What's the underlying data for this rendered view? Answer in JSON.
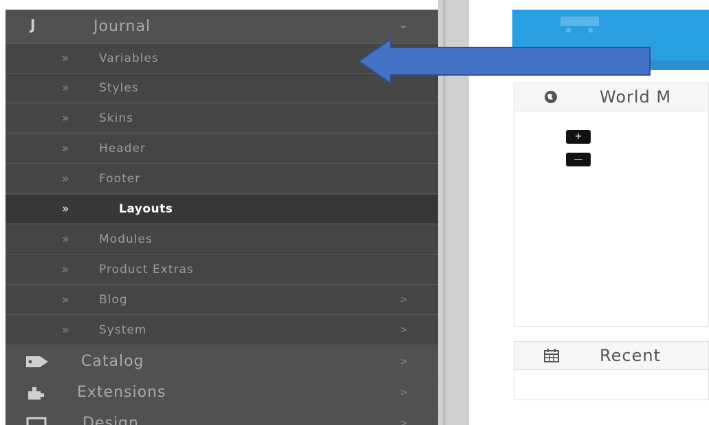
{
  "sidebar": {
    "journal": {
      "icon": "journal-j-icon",
      "label": "Journal"
    },
    "sub_items": [
      {
        "label": "Variables",
        "active": false,
        "has_submenu": false
      },
      {
        "label": "Styles",
        "active": false,
        "has_submenu": false
      },
      {
        "label": "Skins",
        "active": false,
        "has_submenu": false
      },
      {
        "label": "Header",
        "active": false,
        "has_submenu": false
      },
      {
        "label": "Footer",
        "active": false,
        "has_submenu": false
      },
      {
        "label": "Layouts",
        "active": true,
        "has_submenu": false
      },
      {
        "label": "Modules",
        "active": false,
        "has_submenu": false
      },
      {
        "label": "Product Extras",
        "active": false,
        "has_submenu": false
      },
      {
        "label": "Blog",
        "active": false,
        "has_submenu": true
      },
      {
        "label": "System",
        "active": false,
        "has_submenu": true
      }
    ],
    "top_items": [
      {
        "label": "Catalog",
        "icon": "tags-icon"
      },
      {
        "label": "Extensions",
        "icon": "puzzle-icon"
      },
      {
        "label": "Design",
        "icon": "monitor-icon"
      }
    ],
    "chevron_down": "⌄",
    "chevron_right": ">"
  },
  "main": {
    "banner": {
      "icon": "shopping-cart-icon",
      "color": "#279fe0"
    },
    "world_map": {
      "title": "World M",
      "icon": "globe-icon",
      "zoom_in": "+",
      "zoom_out": "—"
    },
    "recent": {
      "title": "Recent",
      "icon": "calendar-icon"
    }
  },
  "annotation": {
    "arrow_color": "#4472c4",
    "direction": "left"
  }
}
